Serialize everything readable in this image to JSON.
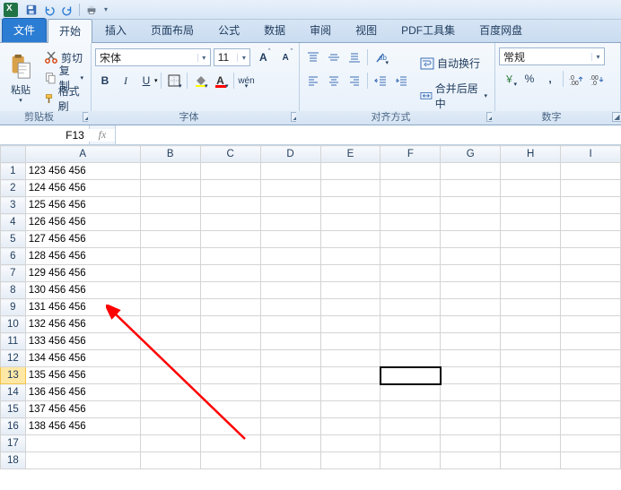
{
  "app": {
    "name": "Excel"
  },
  "tabs": {
    "file": "文件",
    "items": [
      "开始",
      "插入",
      "页面布局",
      "公式",
      "数据",
      "审阅",
      "视图",
      "PDF工具集",
      "百度网盘"
    ],
    "activeIndex": 0
  },
  "ribbon": {
    "clipboard": {
      "label": "剪贴板",
      "paste": "粘贴",
      "cut": "剪切",
      "copy": "复制",
      "format_painter": "格式刷"
    },
    "font": {
      "label": "字体",
      "name": "宋体",
      "size": "11"
    },
    "align": {
      "label": "对齐方式",
      "wrap": "自动换行",
      "merge": "合并后居中"
    },
    "number": {
      "label": "数字",
      "format": "常规"
    }
  },
  "namebox": {
    "value": "F13"
  },
  "formula": {
    "value": ""
  },
  "columns": [
    "A",
    "B",
    "C",
    "D",
    "E",
    "F",
    "G",
    "H",
    "I"
  ],
  "rows": [
    1,
    2,
    3,
    4,
    5,
    6,
    7,
    8,
    9,
    10,
    11,
    12,
    13,
    14,
    15,
    16,
    17,
    18
  ],
  "cells": {
    "A1": "123  456  456",
    "A2": "124  456  456",
    "A3": "125  456  456",
    "A4": "126  456  456",
    "A5": "127  456  456",
    "A6": "128  456  456",
    "A7": "129  456  456",
    "A8": "130  456  456",
    "A9": "131  456  456",
    "A10": "132  456  456",
    "A11": "133  456  456",
    "A12": "134  456  456",
    "A13": "135  456  456",
    "A14": "136  456  456",
    "A15": "137  456  456",
    "A16": "138  456  456"
  },
  "selection": {
    "cell": "F13",
    "row": 13,
    "col": "F"
  },
  "icons": {
    "percent": "%",
    "comma": ",",
    "fx": "fx",
    "bold": "B",
    "italic": "I",
    "underline": "U"
  }
}
